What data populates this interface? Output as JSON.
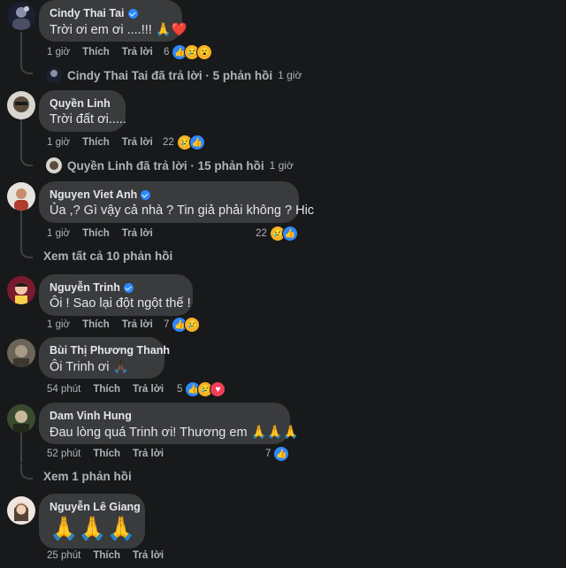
{
  "comments": [
    {
      "name": "Cindy Thai Tai",
      "verified": true,
      "text": "Trời ơi em ơi ....!!! 🙏❤️",
      "time": "1 giờ",
      "like": "Thích",
      "reply": "Trả lời",
      "count": "6",
      "replies": {
        "label": "Cindy Thai Tai đã trả lời · 5 phản hồi",
        "time": "1 giờ"
      }
    },
    {
      "name": "Quyền Linh",
      "verified": false,
      "text": "Trời đất ơi.....",
      "time": "1 giờ",
      "like": "Thích",
      "reply": "Trả lời",
      "count": "22",
      "replies": {
        "label": "Quyền Linh đã trả lời · 15 phản hồi",
        "time": "1 giờ"
      }
    },
    {
      "name": "Nguyen Viet Anh",
      "verified": true,
      "text": "Ủa ,? Gì vậy cả nhà ? Tin giả phải không ? Hic",
      "time": "1 giờ",
      "like": "Thích",
      "reply": "Trả lời",
      "count": "22",
      "view_all": "Xem tất cả 10 phản hồi"
    },
    {
      "name": "Nguyễn Trinh",
      "verified": true,
      "text": "Ôi ! Sao lại đột ngột thế !",
      "time": "1 giờ",
      "like": "Thích",
      "reply": "Trả lời",
      "count": "7"
    },
    {
      "name": "Bùi Thị Phương Thanh",
      "verified": false,
      "text": "Ôi Trinh ơi 🙏🏿",
      "time": "54 phút",
      "like": "Thích",
      "reply": "Trả lời",
      "count": "5"
    },
    {
      "name": "Dam Vinh Hung",
      "verified": false,
      "text": "Đau lòng quá Trinh ơi! Thương em 🙏🙏🙏",
      "time": "52 phút",
      "like": "Thích",
      "reply": "Trả lời",
      "count": "7",
      "view_all": "Xem 1 phản hồi"
    },
    {
      "name": "Nguyễn Lê Giang",
      "verified": false,
      "text": "🙏🙏🙏",
      "time": "25 phút",
      "like": "Thích",
      "reply": "Trả lời"
    }
  ],
  "colors": {
    "background": "#18191a",
    "bubble": "#3a3b3c",
    "like": "#2d88ff",
    "love": "#f33e58",
    "sad": "#f7b125"
  }
}
